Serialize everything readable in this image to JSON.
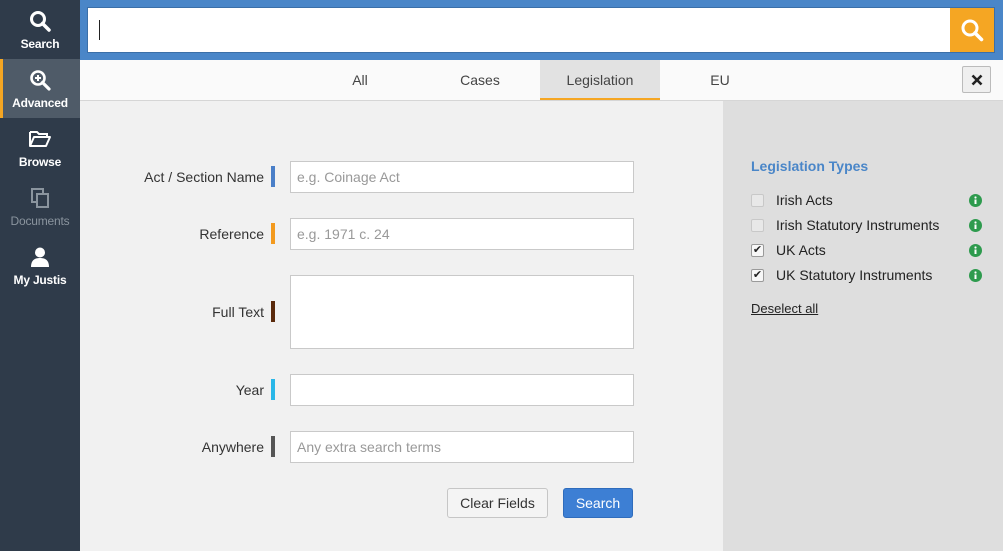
{
  "sidebar": {
    "items": [
      {
        "label": "Search",
        "icon": "search-icon",
        "state": "normal"
      },
      {
        "label": "Advanced",
        "icon": "zoom-plus-icon",
        "state": "active"
      },
      {
        "label": "Browse",
        "icon": "folder-open-icon",
        "state": "normal"
      },
      {
        "label": "Documents",
        "icon": "documents-icon",
        "state": "disabled"
      },
      {
        "label": "My Justis",
        "icon": "user-icon",
        "state": "normal"
      }
    ]
  },
  "search": {
    "value": "",
    "button_icon": "search-icon"
  },
  "tabs": {
    "items": [
      {
        "label": "All",
        "active": false
      },
      {
        "label": "Cases",
        "active": false
      },
      {
        "label": "Legislation",
        "active": true
      },
      {
        "label": "EU",
        "active": false
      }
    ],
    "close_icon": "close-icon"
  },
  "form": {
    "act_section": {
      "label": "Act / Section Name",
      "placeholder": "e.g. Coinage Act",
      "value": "",
      "color": "#4a7fc8"
    },
    "reference": {
      "label": "Reference",
      "placeholder": "e.g. 1971 c. 24",
      "value": "",
      "color": "#f39a1e"
    },
    "full_text": {
      "label": "Full Text",
      "placeholder": "",
      "value": "",
      "color": "#5a2a0c"
    },
    "year": {
      "label": "Year",
      "placeholder": "",
      "value": "",
      "color": "#29b7e8"
    },
    "anywhere": {
      "label": "Anywhere",
      "placeholder": "Any extra search terms",
      "value": "",
      "color": "#555555"
    },
    "clear_label": "Clear Fields",
    "search_label": "Search"
  },
  "legislation_types": {
    "title": "Legislation Types",
    "items": [
      {
        "label": "Irish Acts",
        "checked": false
      },
      {
        "label": "Irish Statutory Instruments",
        "checked": false
      },
      {
        "label": "UK Acts",
        "checked": true
      },
      {
        "label": "UK Statutory Instruments",
        "checked": true
      }
    ],
    "info_icon": "info-icon",
    "deselect_label": "Deselect all"
  },
  "colors": {
    "accent": "#f5a623",
    "brand_blue": "#4a86c8",
    "sidebar": "#2f3b4a",
    "info_green": "#2e9b4e"
  }
}
